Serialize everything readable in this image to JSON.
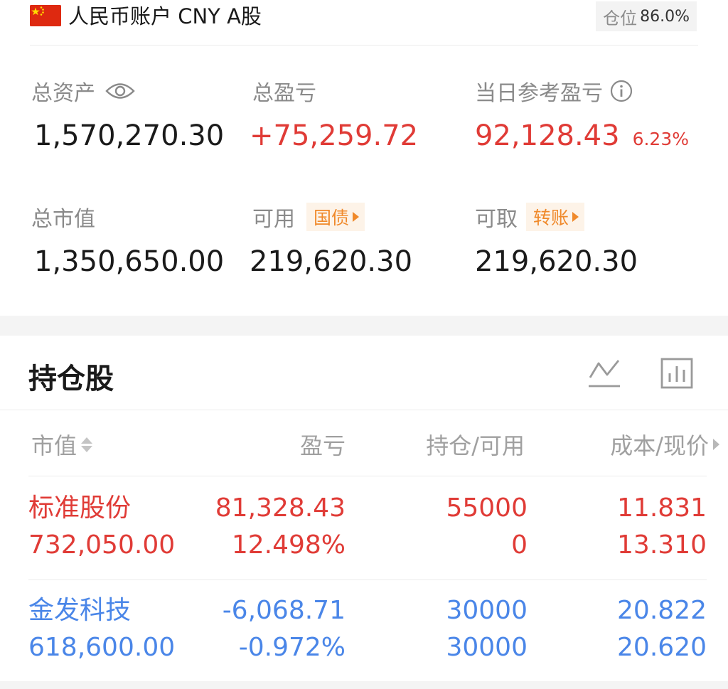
{
  "header": {
    "account_name": "人民币账户 CNY A股",
    "position_label": "仓位",
    "position_value": "86.0%"
  },
  "summary": {
    "total_assets": {
      "label": "总资产",
      "value": "1,570,270.30"
    },
    "total_pnl": {
      "label": "总盈亏",
      "value": "+75,259.72"
    },
    "daily_pnl": {
      "label": "当日参考盈亏",
      "value": "92,128.43",
      "percent": "6.23%"
    },
    "market_value": {
      "label": "总市值",
      "value": "1,350,650.00"
    },
    "available": {
      "label": "可用",
      "button": "国债",
      "value": "219,620.30"
    },
    "withdrawable": {
      "label": "可取",
      "button": "转账",
      "value": "219,620.30"
    }
  },
  "holdings": {
    "title": "持仓股",
    "columns": {
      "market_value": "市值",
      "pnl": "盈亏",
      "position": "持仓/可用",
      "cost": "成本/现价"
    },
    "rows": [
      {
        "name": "标准股份",
        "market_value": "732,050.00",
        "pnl": "81,328.43",
        "pnl_pct": "12.498%",
        "position": "55000",
        "available": "0",
        "cost": "11.831",
        "price": "13.310",
        "color": "#e03b36"
      },
      {
        "name": "金发科技",
        "market_value": "618,600.00",
        "pnl": "-6,068.71",
        "pnl_pct": "-0.972%",
        "position": "30000",
        "available": "30000",
        "cost": "20.822",
        "price": "20.620",
        "color": "#4a86e8"
      }
    ]
  },
  "colors": {
    "up": "#e03b36",
    "down": "#4a86e8",
    "tag": "#f0892a",
    "label": "#8a8a8a"
  },
  "icons": {
    "flag": "china-flag-icon",
    "visibility": "eye-icon",
    "info": "info-icon",
    "trend": "line-chart-icon",
    "bars": "bar-chart-icon"
  }
}
